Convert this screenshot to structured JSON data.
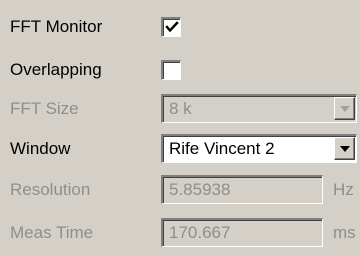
{
  "rows": {
    "fft_monitor": {
      "label": "FFT Monitor",
      "checked": true
    },
    "overlapping": {
      "label": "Overlapping",
      "checked": false
    },
    "fft_size": {
      "label": "FFT Size",
      "value": "8 k",
      "enabled": false
    },
    "window": {
      "label": "Window",
      "value": "Rife Vincent 2",
      "enabled": true
    },
    "resolution": {
      "label": "Resolution",
      "value": "5.85938",
      "unit": "Hz",
      "enabled": false
    },
    "meas_time": {
      "label": "Meas Time",
      "value": "170.667",
      "unit": "ms",
      "enabled": false
    }
  },
  "colors": {
    "panel_bg": "#d4d0c8",
    "disabled_text": "#8e8e8e",
    "field_bg": "#ffffff"
  }
}
